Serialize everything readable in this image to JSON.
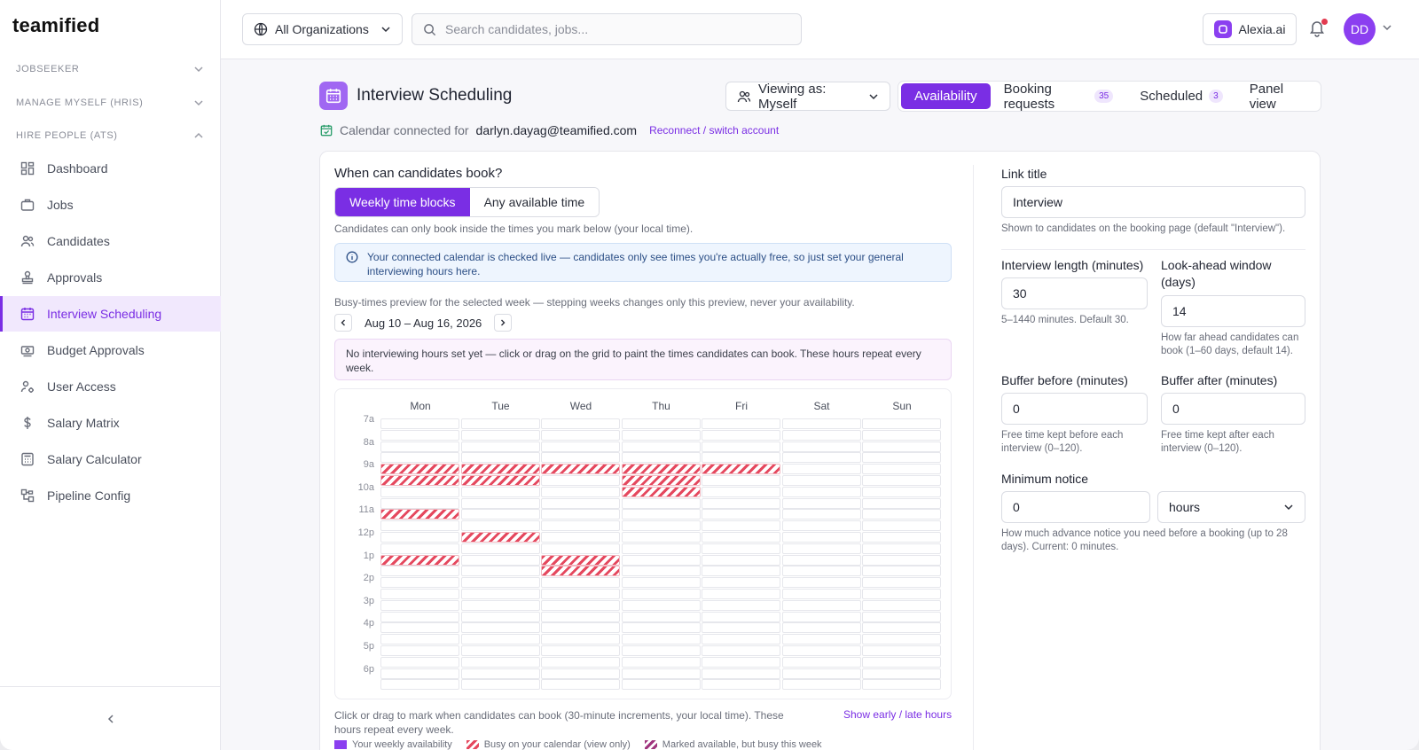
{
  "brand": {
    "logo": "teamified",
    "accent": "#7a2ee4"
  },
  "sidebar": {
    "sections": [
      {
        "label": "JOBSEEKER",
        "state": "collapsed"
      },
      {
        "label": "MANAGE MYSELF (HRIS)",
        "state": "collapsed"
      },
      {
        "label": "HIRE PEOPLE (ATS)",
        "state": "expanded"
      }
    ],
    "items": [
      {
        "label": "Dashboard",
        "icon": "dashboard-icon"
      },
      {
        "label": "Jobs",
        "icon": "briefcase-icon"
      },
      {
        "label": "Candidates",
        "icon": "users-icon"
      },
      {
        "label": "Approvals",
        "icon": "stamp-icon"
      },
      {
        "label": "Interview Scheduling",
        "icon": "calendar-icon",
        "active": true
      },
      {
        "label": "Budget Approvals",
        "icon": "money-icon"
      },
      {
        "label": "User Access",
        "icon": "user-gear-icon"
      },
      {
        "label": "Salary Matrix",
        "icon": "dollar-icon"
      },
      {
        "label": "Salary Calculator",
        "icon": "calculator-icon"
      },
      {
        "label": "Pipeline Config",
        "icon": "pipeline-icon"
      }
    ]
  },
  "topbar": {
    "org_select": "All Organizations",
    "search_placeholder": "Search candidates, jobs...",
    "assistant": "Alexia.ai",
    "avatar_initials": "DD"
  },
  "page": {
    "title": "Interview Scheduling",
    "viewing_as": "Viewing as: Myself",
    "tabs": [
      {
        "label": "Availability",
        "active": true
      },
      {
        "label": "Booking requests",
        "count": "35"
      },
      {
        "label": "Scheduled",
        "count": "3"
      },
      {
        "label": "Panel view"
      }
    ],
    "calendar_connected_prefix": "Calendar connected for",
    "calendar_email": "darlyn.dayag@teamified.com",
    "reconnect_link": "Reconnect / switch account"
  },
  "availability": {
    "question": "When can candidates book?",
    "mode_options": [
      "Weekly time blocks",
      "Any available time"
    ],
    "mode_selected": "Weekly time blocks",
    "mode_hint": "Candidates can only book inside the times you mark below (your local time).",
    "info": "Your connected calendar is checked live — candidates only see times you're actually free, so just set your general interviewing hours here.",
    "preview_hint": "Busy-times preview for the selected week — stepping weeks changes only this preview, never your availability.",
    "week_range": "Aug 10 – Aug 16, 2026",
    "warning": "No interviewing hours set yet — click or drag on the grid to paint the times candidates can book. These hours repeat every week.",
    "days": [
      "Mon",
      "Tue",
      "Wed",
      "Thu",
      "Fri",
      "Sat",
      "Sun"
    ],
    "hours": [
      "7a",
      "8a",
      "9a",
      "10a",
      "11a",
      "12p",
      "1p",
      "2p",
      "3p",
      "4p",
      "5p",
      "6p"
    ],
    "busy_slots": {
      "Mon": [
        "9:00",
        "9:30",
        "11:00",
        "13:00"
      ],
      "Tue": [
        "9:00",
        "9:30",
        "12:00"
      ],
      "Wed": [
        "9:00",
        "13:00",
        "13:30"
      ],
      "Thu": [
        "9:00",
        "9:30",
        "10:00"
      ],
      "Fri": [
        "9:00"
      ]
    },
    "footer_hint": "Click or drag to mark when candidates can book (30-minute increments, your local time). These hours repeat every week.",
    "show_early_late": "Show early / late hours",
    "legend": [
      "Your weekly availability",
      "Busy on your calendar (view only)",
      "Marked available, but busy this week"
    ],
    "colors": {
      "available": "#8b3ff0",
      "busy": "#e5485e",
      "conflict": "#a0357e"
    }
  },
  "settings": {
    "link_title_label": "Link title",
    "link_title_value": "Interview",
    "link_title_hint": "Shown to candidates on the booking page (default \"Interview\").",
    "length_label": "Interview length (minutes)",
    "length_value": "30",
    "length_hint": "5–1440 minutes. Default 30.",
    "lookahead_label": "Look-ahead window (days)",
    "lookahead_value": "14",
    "lookahead_hint": "How far ahead candidates can book (1–60 days, default 14).",
    "buffer_before_label": "Buffer before (minutes)",
    "buffer_before_value": "0",
    "buffer_before_hint": "Free time kept before each interview (0–120).",
    "buffer_after_label": "Buffer after (minutes)",
    "buffer_after_value": "0",
    "buffer_after_hint": "Free time kept after each interview (0–120).",
    "min_notice_label": "Minimum notice",
    "min_notice_value": "0",
    "min_notice_unit": "hours",
    "min_notice_hint": "How much advance notice you need before a booking (up to 28 days). Current: 0 minutes."
  }
}
